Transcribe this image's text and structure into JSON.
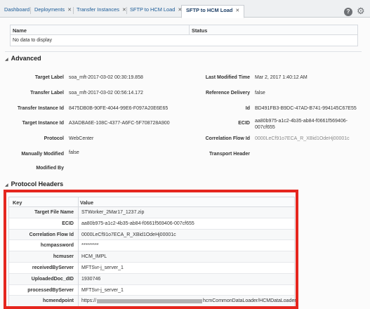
{
  "tabs": [
    {
      "label": "Dashboard",
      "closable": false
    },
    {
      "label": "Deployments",
      "closable": true
    },
    {
      "label": "Transfer Instances",
      "closable": true
    },
    {
      "label": "SFTP to HCM Load",
      "closable": true
    },
    {
      "label": "SFTP to HCM Load",
      "closable": true,
      "active": true
    }
  ],
  "tab_close_glyph": "✕",
  "toolbar": {
    "help_glyph": "?",
    "gear_glyph": "⚙"
  },
  "top_table": {
    "columns": [
      "Name",
      "Status"
    ],
    "empty_text": "No data to display"
  },
  "advanced": {
    "title": "Advanced",
    "left": [
      {
        "label": "Target Label",
        "value": "soa_mft-2017-03-02 00:30:19.858"
      },
      {
        "label": "Transfer Label",
        "value": "soa_mft-2017-03-02 00:56:14.172"
      },
      {
        "label": "Transfer Instance Id",
        "value": "8475DB0B-90FE-4044-99E6-F097A20E6E65"
      },
      {
        "label": "Target Instance Id",
        "value": "A3ADBA6E-108C-4377-A6FC-5F708728A900"
      },
      {
        "label": "Protocol",
        "value": "WebCenter"
      },
      {
        "label": "Manually Modified",
        "value": "false"
      },
      {
        "label": "Modified By",
        "value": ""
      }
    ],
    "right": [
      {
        "label": "Last Modified Time",
        "value": "Mar 2, 2017 1:40:12 AM"
      },
      {
        "label": "Reference Delivery",
        "value": "false"
      },
      {
        "label": "Id",
        "value": "BD491FB3-B9DC-47AD-B741-994145C67E55"
      },
      {
        "label": "ECID",
        "value": "aa80b975-a1c2-4b35-ab84-f0661f569406-007cf655"
      },
      {
        "label": "Correlation Flow Id",
        "value": "0000LeCf91o7ECA_R_XBid1OdeHj00001c"
      },
      {
        "label": "Transport Header",
        "value": ""
      }
    ]
  },
  "protocol_headers": {
    "title": "Protocol Headers",
    "columns": [
      "Key",
      "Value"
    ],
    "rows": [
      {
        "key": "Target File Name",
        "value": "STWorker_2Mar17_1237.zip"
      },
      {
        "key": "ECID",
        "value": "aa80b975-a1c2-4b35-ab84-f0661f569406-007cf655"
      },
      {
        "key": "Correlation Flow Id",
        "value": "0000LeCf91o7ECA_R_XBid1OdeHj00001c"
      },
      {
        "key": "hcmpassword",
        "value": "*********"
      },
      {
        "key": "hcmuser",
        "value": "HCM_IMPL"
      },
      {
        "key": "receivedByServer",
        "value": "MFTSvr-j_server_1"
      },
      {
        "key": "UploadedDoc_dID",
        "value": "1930746"
      },
      {
        "key": "processedByServer",
        "value": "MFTSvr-j_server_1"
      },
      {
        "key": "hcmendpoint",
        "value_prefix": "https://",
        "value_suffix": "hcmCommonDataLoader/HCMDataLoader"
      }
    ]
  },
  "colors": {
    "accent_red": "#e5261e",
    "tab_link": "#1a5a96"
  }
}
